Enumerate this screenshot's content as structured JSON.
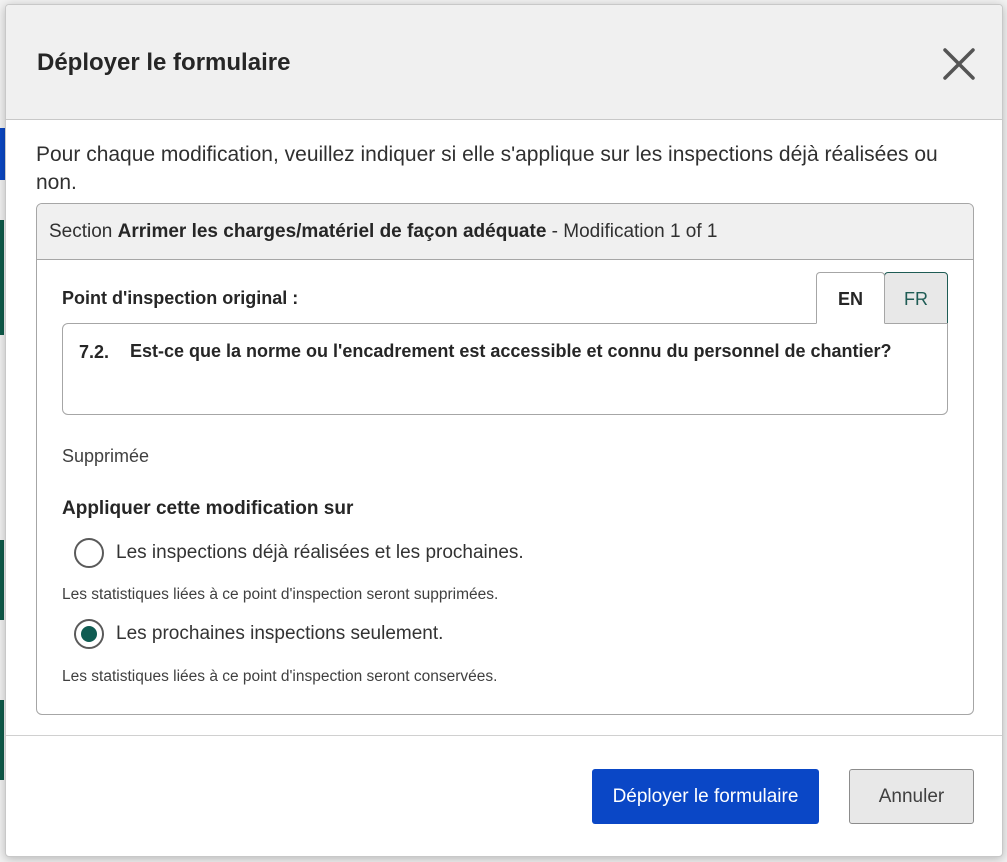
{
  "dialog": {
    "title": "Déployer le formulaire",
    "close_icon": "close-icon",
    "intro": "Pour chaque modification, veuillez indiquer si elle s'applique sur les inspections déjà réalisées ou non."
  },
  "section": {
    "prefix": "Section",
    "name": "Arrimer les charges/matériel de façon adéquate",
    "suffix": "- Modification 1 of 1"
  },
  "original_point": {
    "label": "Point d'inspection original :",
    "tabs": [
      {
        "label": "EN",
        "selected": true
      },
      {
        "label": "FR",
        "selected": false
      }
    ],
    "number": "7.2.",
    "question": "Est-ce que la norme ou l'encadrement est accessible et connu du personnel de chantier?"
  },
  "status": "Supprimée",
  "apply": {
    "label": "Appliquer cette modification sur",
    "options": [
      {
        "label": "Les inspections déjà réalisées et les prochaines.",
        "hint": "Les statistiques liées à ce point d'inspection seront supprimées.",
        "checked": false
      },
      {
        "label": "Les prochaines inspections seulement.",
        "hint": "Les statistiques liées à ce point d'inspection seront conservées.",
        "checked": true
      }
    ]
  },
  "footer": {
    "deploy_label": "Déployer le formulaire",
    "cancel_label": "Annuler"
  },
  "colors": {
    "primary": "#0a47c6",
    "radio_checked": "#0f5c52",
    "fr_tab": "#1f5c55"
  }
}
